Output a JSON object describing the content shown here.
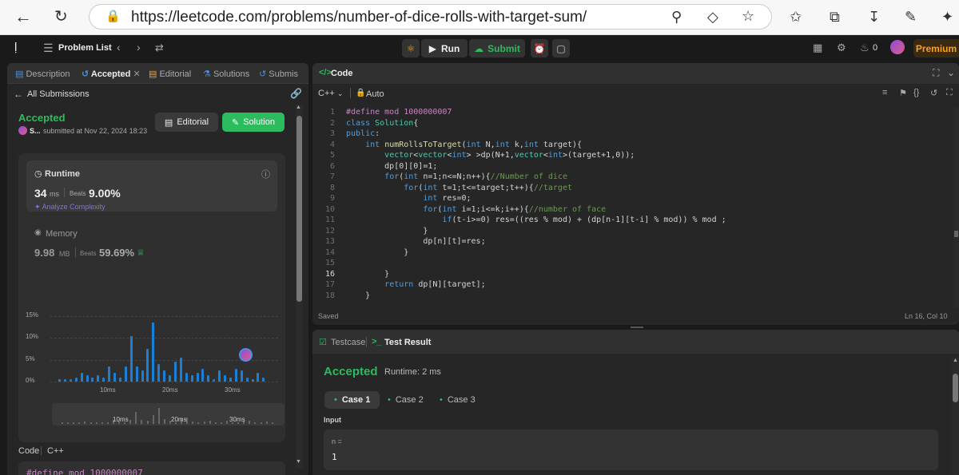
{
  "browser": {
    "url": "https://leetcode.com/problems/number-of-dice-rolls-with-target-sum/"
  },
  "header": {
    "problem_list": "Problem List",
    "run": "Run",
    "submit": "Submit",
    "streak": "0",
    "premium": "Premium"
  },
  "left": {
    "tabs": [
      "Description",
      "Accepted",
      "Editorial",
      "Solutions",
      "Submis"
    ],
    "all_submissions": "All Submissions",
    "status": "Accepted",
    "user": "S...",
    "submitted": "submitted at Nov 22, 2024 18:23",
    "editorial_btn": "Editorial",
    "solution_btn": "Solution",
    "runtime_label": "Runtime",
    "runtime_value": "34",
    "runtime_unit": "ms",
    "beats_label": "Beats",
    "runtime_beats": "9.00%",
    "analyze": "Analyze Complexity",
    "memory_label": "Memory",
    "memory_value": "9.98",
    "memory_unit": "MB",
    "memory_beats": "59.69%",
    "code_label": "Code",
    "lang_label": "C++",
    "code_preview": "#define mod 1000000007"
  },
  "chart_data": {
    "type": "bar",
    "y_ticks": [
      "15%",
      "10%",
      "5%",
      "0%"
    ],
    "x_ticks": [
      "10ms",
      "20ms",
      "30ms"
    ],
    "ylim": [
      0,
      15
    ],
    "values": [
      0.5,
      0.5,
      0.5,
      1,
      2,
      1.5,
      1,
      1.5,
      1,
      3.5,
      2,
      1,
      3.5,
      10.5,
      3.5,
      2.5,
      7.5,
      13.5,
      4,
      2.5,
      1.5,
      4.5,
      5.5,
      2,
      1.5,
      2,
      3,
      1.5,
      0.5,
      2.5,
      1.5,
      1,
      3,
      2.5,
      1,
      0.5,
      2,
      1
    ],
    "mini_x_ticks": [
      "10ms",
      "20ms",
      "30ms"
    ]
  },
  "code": {
    "title": "Code",
    "lang": "C++",
    "mode": "Auto",
    "saved": "Saved",
    "cursor": "Ln 16, Col 10",
    "lines": [
      "#define mod 1000000007",
      "class Solution{",
      "public:",
      "    int numRollsToTarget(int N,int k,int target){",
      "        vector<vector<int> >dp(N+1,vector<int>(target+1,0));",
      "        dp[0][0]=1;",
      "        for(int n=1;n<=N;n++){//Number of dice",
      "            for(int t=1;t<=target;t++){//target",
      "                int res=0;",
      "                for(int i=1;i<=k;i++){//number of face",
      "                    if(t-i>=0) res=((res % mod) + (dp[n-1][t-i] % mod)) % mod ;",
      "                }",
      "                dp[n][t]=res;",
      "            }",
      "",
      "        }",
      "        return dp[N][target];",
      "    }"
    ]
  },
  "test": {
    "testcase_tab": "Testcase",
    "result_tab": "Test Result",
    "status": "Accepted",
    "runtime": "Runtime: 2 ms",
    "cases": [
      "Case 1",
      "Case 2",
      "Case 3"
    ],
    "input_label": "Input",
    "var_name": "n =",
    "var_value": "1"
  }
}
